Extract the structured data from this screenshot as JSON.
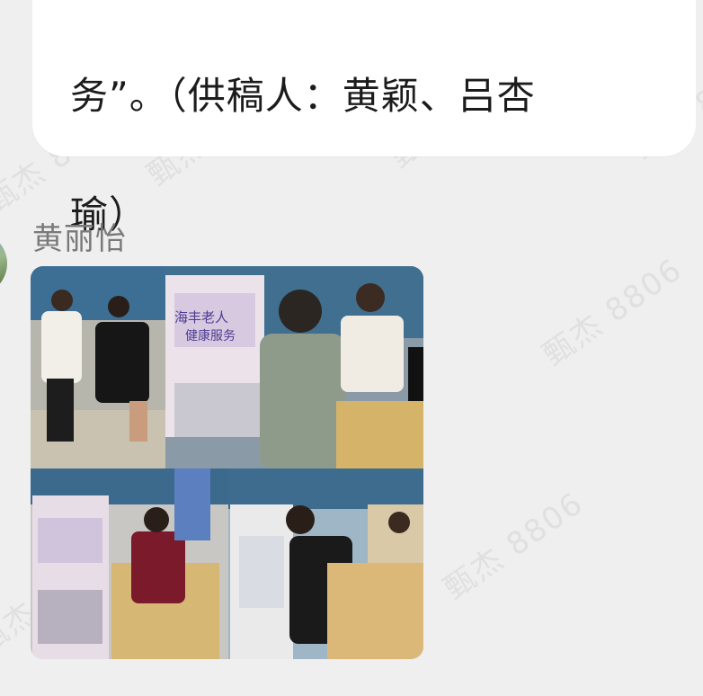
{
  "message": {
    "text_lines": [
      "务”。（供稿人：黄颖、吕杏",
      "瑜）"
    ]
  },
  "sender": {
    "name": "黄丽怡"
  },
  "photo": {
    "poster_caption_1": "海丰老人",
    "poster_caption_2": "健康服务"
  },
  "watermark": {
    "text": "甄杰 8806"
  }
}
